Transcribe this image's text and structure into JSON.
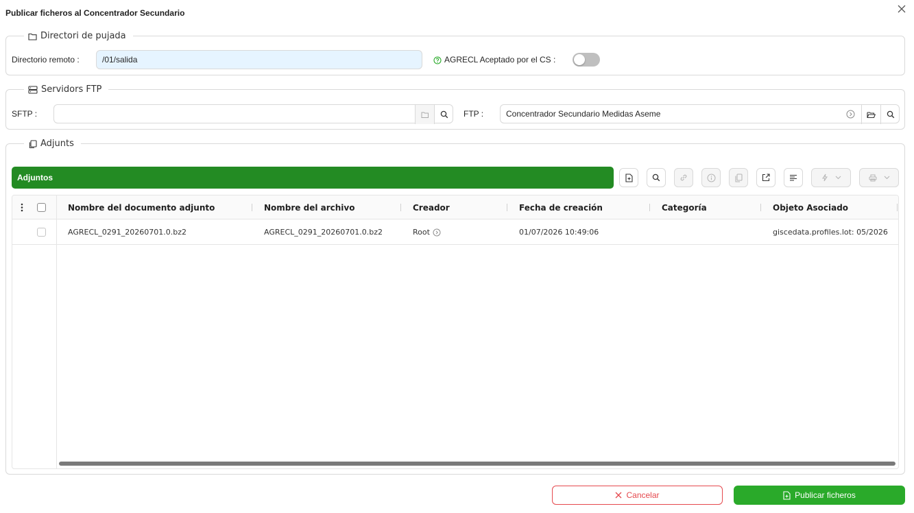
{
  "dialog": {
    "title": "Publicar ficheros al Concentrador Secundario"
  },
  "upload_dir": {
    "legend": "Directori de pujada",
    "remote_dir_label": "Directorio remoto :",
    "remote_dir_value": "/01/salida",
    "accepted_label": "AGRECL Aceptado por el CS :",
    "accepted_value": false
  },
  "ftp_servers": {
    "legend": "Servidors FTP",
    "sftp_label": "SFTP :",
    "sftp_value": "",
    "ftp_label": "FTP :",
    "ftp_value": "Concentrador Secundario Medidas Aseme"
  },
  "attachments": {
    "legend": "Adjunts",
    "bar_title": "Adjuntos",
    "columns": [
      "Nombre del documento adjunto",
      "Nombre del archivo",
      "Creador",
      "Fecha de creación",
      "Categoría",
      "Objeto Asociado"
    ],
    "rows": [
      {
        "document_name": "AGRECL_0291_20260701.0.bz2",
        "file_name": "AGRECL_0291_20260701.0.bz2",
        "creator": "Root",
        "created": "01/07/2026 10:49:06",
        "category": "",
        "object": "giscedata.profiles.lot: 05/2026"
      }
    ]
  },
  "footer": {
    "cancel_label": "Cancelar",
    "publish_label": "Publicar ficheros"
  },
  "colors": {
    "accent_green": "#238b23",
    "publish_green": "#2aaa2a",
    "danger": "#e5484d",
    "input_highlight": "#e6f4ff"
  },
  "icons": {
    "close": "close-icon",
    "folder": "folder-icon",
    "server": "server-icon",
    "attachments": "copy-icon",
    "help": "help-circle-icon",
    "search": "search-icon",
    "new_file": "file-add-icon",
    "link": "link-icon",
    "info": "info-icon",
    "clone": "copy-icon",
    "export": "export-icon",
    "align": "align-left-icon",
    "action": "thunderbolt-icon",
    "print": "printer-icon"
  }
}
